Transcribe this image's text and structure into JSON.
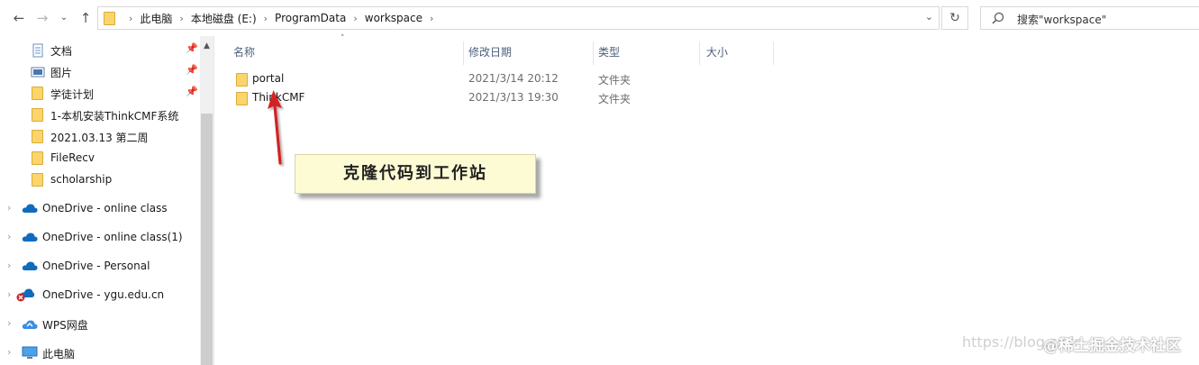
{
  "address_bar": {
    "breadcrumbs": [
      "此电脑",
      "本地磁盘 (E:)",
      "ProgramData",
      "workspace"
    ]
  },
  "search": {
    "placeholder": "搜索\"workspace\""
  },
  "sidebar": {
    "quick_access": [
      {
        "label": "文档",
        "icon": "documents-icon",
        "pinned": true
      },
      {
        "label": "图片",
        "icon": "pictures-icon",
        "pinned": true
      },
      {
        "label": "学徒计划",
        "icon": "folder-icon",
        "pinned": true
      },
      {
        "label": "1-本机安装ThinkCMF系统",
        "icon": "folder-icon",
        "pinned": false
      },
      {
        "label": "2021.03.13 第二周",
        "icon": "folder-icon",
        "pinned": false
      },
      {
        "label": "FileRecv",
        "icon": "folder-icon",
        "pinned": false
      },
      {
        "label": "scholarship",
        "icon": "folder-icon",
        "pinned": false
      }
    ],
    "locations": [
      {
        "label": "OneDrive - online class",
        "icon": "onedrive-icon"
      },
      {
        "label": "OneDrive - online class(1)",
        "icon": "onedrive-icon"
      },
      {
        "label": "OneDrive - Personal",
        "icon": "onedrive-icon"
      },
      {
        "label": "OneDrive - ygu.edu.cn",
        "icon": "onedrive-error-icon"
      },
      {
        "label": "WPS网盘",
        "icon": "wps-cloud-icon"
      },
      {
        "label": "此电脑",
        "icon": "computer-icon"
      }
    ]
  },
  "columns": {
    "name": "名称",
    "modified": "修改日期",
    "type": "类型",
    "size": "大小"
  },
  "files": [
    {
      "name": "portal",
      "modified": "2021/3/14 20:12",
      "type": "文件夹"
    },
    {
      "name": "ThinkCMF",
      "modified": "2021/3/13 19:30",
      "type": "文件夹"
    }
  ],
  "annotation": {
    "text": "克隆代码到工作站"
  },
  "watermark": {
    "url": "https://blog.csdn",
    "site": "@稀土掘金技术社区"
  },
  "colors": {
    "folder": "#fbd56b",
    "annotation_bg": "#fdfbd4",
    "arrow": "#d42020",
    "header_text": "#4c607a"
  }
}
